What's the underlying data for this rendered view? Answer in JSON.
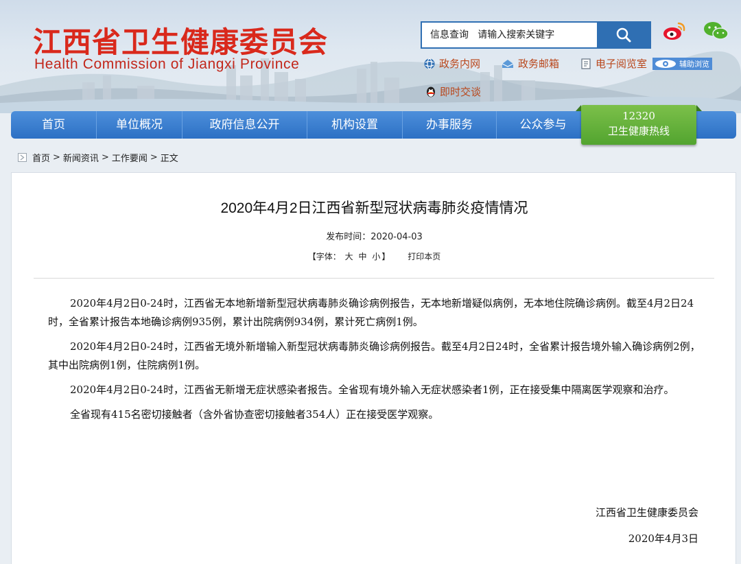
{
  "header": {
    "logo_cn": "江西省卫生健康委员会",
    "logo_en": "Health Commission of Jiangxi Province",
    "search": {
      "category": "信息查询",
      "placeholder": "请输入搜索关键字"
    },
    "links": [
      {
        "label": "政务内网",
        "icon": "globe-icon"
      },
      {
        "label": "政务邮箱",
        "icon": "mail-icon"
      },
      {
        "label": "电子阅览室",
        "icon": "book-icon"
      }
    ],
    "assist_label": "辅助浏览",
    "chat_label": "即时交谈",
    "colors": {
      "logo_red": "#d9291c",
      "nav_blue": "#2c70c4",
      "link_orange": "#b9461a",
      "hotline_green": "#52a42f"
    }
  },
  "nav": {
    "items": [
      "首页",
      "单位概况",
      "政府信息公开",
      "机构设置",
      "办事服务",
      "公众参与"
    ],
    "hotline_number": "12320",
    "hotline_label": "卫生健康热线"
  },
  "breadcrumb": [
    "首页",
    "新闻资讯",
    "工作要闻",
    "正文"
  ],
  "article": {
    "title": "2020年4月2日江西省新型冠状病毒肺炎疫情情况",
    "publish_label": "发布时间：",
    "publish_date": "2020-04-03",
    "font_label": "【字体：",
    "font_sizes": [
      "大",
      "中",
      "小"
    ],
    "font_close": "】",
    "print_label": "打印本页",
    "paragraphs": [
      "2020年4月2日0-24时，江西省无本地新增新型冠状病毒肺炎确诊病例报告，无本地新增疑似病例，无本地住院确诊病例。截至4月2日24时，全省累计报告本地确诊病例935例，累计出院病例934例，累计死亡病例1例。",
      "2020年4月2日0-24时，江西省无境外新增输入新型冠状病毒肺炎确诊病例报告。截至4月2日24时，全省累计报告境外输入确诊病例2例，其中出院病例1例，住院病例1例。",
      "2020年4月2日0-24时，江西省无新增无症状感染者报告。全省现有境外输入无症状感染者1例，正在接受集中隔离医学观察和治疗。",
      "全省现有415名密切接触者（含外省协查密切接触者354人）正在接受医学观察。"
    ],
    "signature": "江西省卫生健康委员会",
    "sign_date": "2020年4月3日"
  }
}
